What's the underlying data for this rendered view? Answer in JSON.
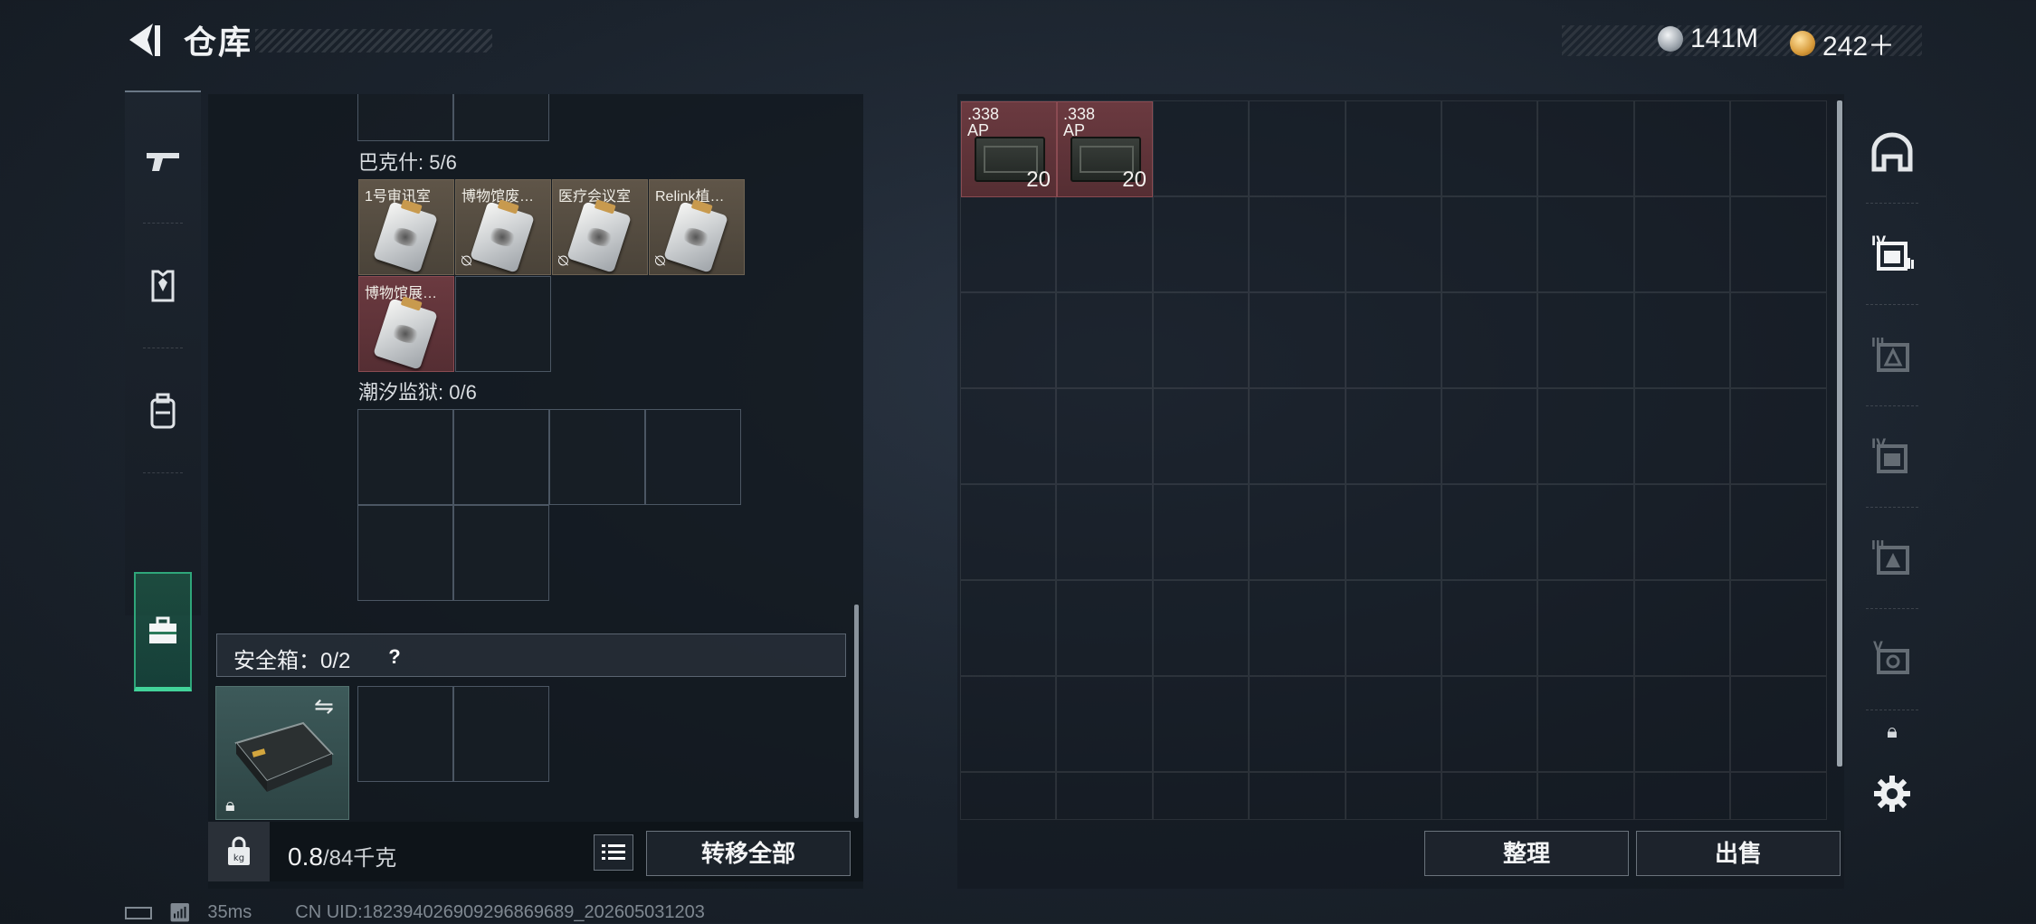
{
  "header": {
    "title": "仓库"
  },
  "currency": [
    {
      "icon": "silver-coin-icon",
      "value": "141M"
    },
    {
      "icon": "gold-coin-icon",
      "value": "242＋"
    }
  ],
  "left_nav": {
    "items": [
      "gun-icon",
      "armor-vest-icon",
      "backpack-icon",
      "briefcase-icon"
    ],
    "active": "briefcase-icon"
  },
  "collections": [
    {
      "label": "巴克什: 5/6",
      "items": [
        {
          "name": "1号审讯室",
          "color": "gold",
          "no_drop": false
        },
        {
          "name": "博物馆废…",
          "color": "gold",
          "no_drop": true
        },
        {
          "name": "医疗会议室",
          "color": "gold",
          "no_drop": true
        },
        {
          "name": "Relink植…",
          "color": "gold",
          "no_drop": true
        },
        {
          "name": "博物馆展…",
          "color": "red",
          "no_drop": false
        }
      ]
    },
    {
      "label": "潮汐监狱: 0/6",
      "items": []
    }
  ],
  "safe_box": {
    "label": "安全箱：0/2",
    "help": "?"
  },
  "bottom_left": {
    "weight_value": "0.8",
    "weight_unit": "/84千克",
    "transfer_all": "转移全部"
  },
  "stash_items": [
    {
      "caliber": ".338\nAP",
      "count": "20"
    },
    {
      "caliber": ".338\nAP",
      "count": "20"
    }
  ],
  "bottom_right": {
    "sort": "整理",
    "sell": "出售"
  },
  "right_nav": [
    "helmet-icon",
    "stash-tab-iv-icon",
    "stash-tab-triangle-icon",
    "stash-tab-iv-alt-icon",
    "stash-tab-iii-icon",
    "stash-tab-v-icon"
  ],
  "status": {
    "ping": "35ms",
    "uid": "CN UID:18239402690929686968​9_202605031203"
  },
  "colors": {
    "accent_green": "#42d39a",
    "item_gold": "#5f5548",
    "item_red": "#6b3a40"
  }
}
